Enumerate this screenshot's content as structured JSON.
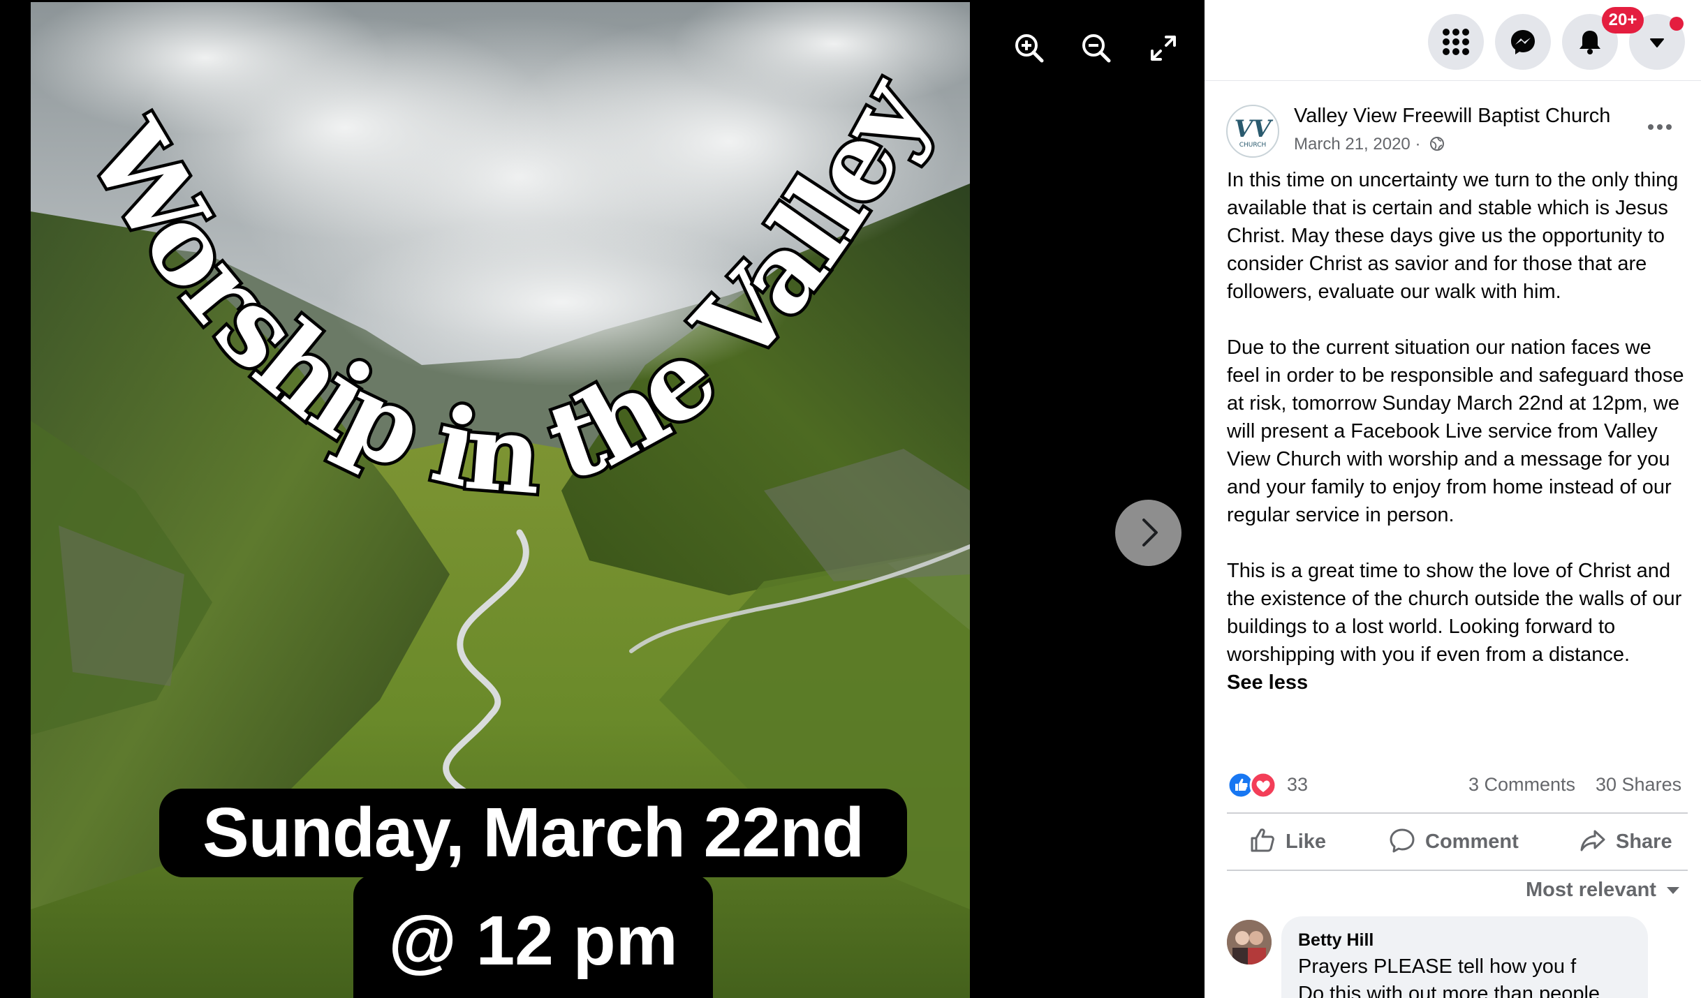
{
  "photo": {
    "headline": "Worship in the Valley",
    "date_line1": "Sunday, March 22nd",
    "date_line2": "@ 12 pm"
  },
  "viewer_controls": {
    "icons": [
      "zoom-in-icon",
      "zoom-out-icon",
      "fullscreen-icon",
      "chevron-right-icon"
    ]
  },
  "header": {
    "icons": [
      "menu-grid-icon",
      "messenger-icon",
      "bell-icon",
      "caret-down-icon"
    ],
    "notifications_badge": "20+"
  },
  "post": {
    "page_name": "Valley View Freewill Baptist Church",
    "date": "March 21, 2020",
    "meta_separator": " · ",
    "audience_icon": "globe-icon",
    "avatar_text": "CHURCH",
    "paragraphs": [
      "In this time on uncertainty we turn to the only thing available that is certain and stable which is Jesus Christ. May these days give us the opportunity to consider Christ as savior and for those that are followers, evaluate our walk with him.",
      "Due to the current situation our nation faces we feel in order to be responsible and safeguard those at risk, tomorrow Sunday March 22nd at 12pm, we will present a Facebook Live service from Valley View Church with worship and a message for you and your family to enjoy from home instead of our regular service in person.",
      "This is a great time to show the love of Christ and the existence of the church outside the walls of our buildings to a lost world. Looking forward to worshipping with you if even from a distance."
    ],
    "see_less": "See less",
    "reaction_count": "33",
    "comments": "3 Comments",
    "shares": "30 Shares"
  },
  "actions": {
    "like": "Like",
    "comment": "Comment",
    "share": "Share"
  },
  "comments_section": {
    "sort_label": "Most relevant",
    "first_comment": {
      "author": "Betty Hill",
      "text_line1": "Prayers PLEASE tell how you f",
      "text_line2": "Do this with out more than people"
    }
  },
  "colors": {
    "facebook_blue": "#1877f2",
    "love_red": "#f33e58",
    "badge_red": "#e41e3f",
    "secondary_text": "#65676b"
  }
}
